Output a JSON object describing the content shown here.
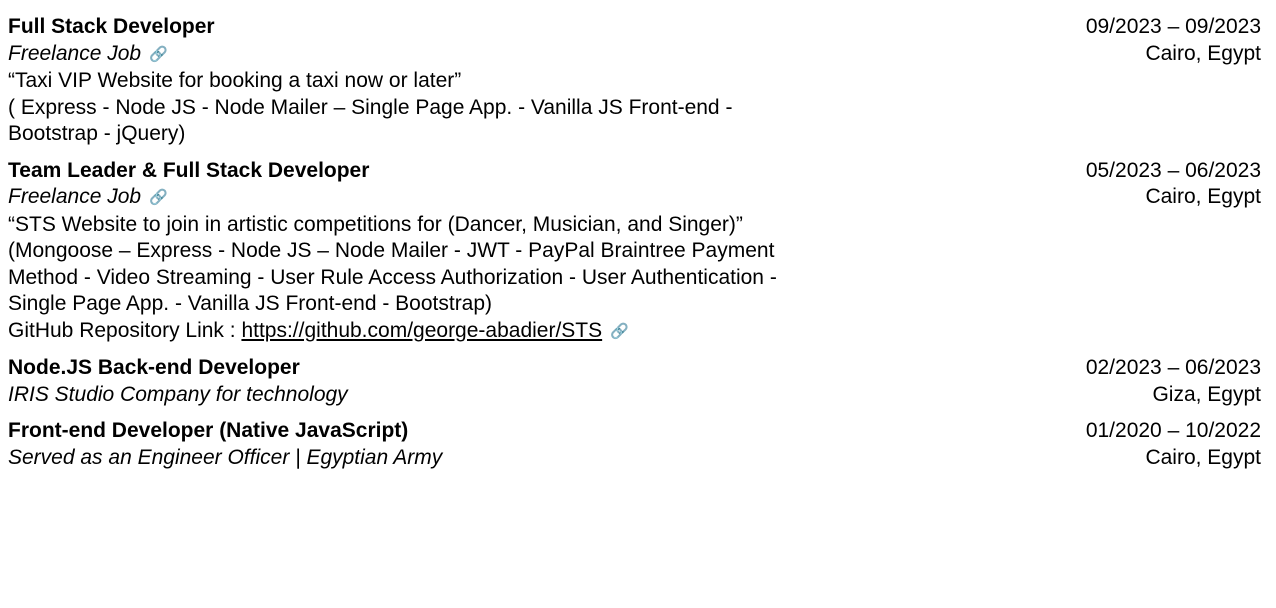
{
  "link_icon": "🔗",
  "entries": [
    {
      "title": "Full Stack Developer",
      "company": "Freelance Job",
      "has_link_icon": true,
      "lines": [
        "“Taxi VIP Website for booking a taxi now or later”",
        "( Express - Node JS - Node Mailer – Single Page App. - Vanilla JS Front-end - Bootstrap - jQuery)"
      ],
      "dates": "09/2023 – 09/2023",
      "location": "Cairo, Egypt"
    },
    {
      "title": "Team Leader & Full Stack Developer",
      "company": "Freelance Job",
      "has_link_icon": true,
      "lines": [
        "“STS Website to join in artistic competitions for (Dancer, Musician, and Singer)”",
        "(Mongoose – Express - Node JS – Node Mailer - JWT - PayPal Braintree Payment Method - Video Streaming - User Rule Access Authorization - User Authentication - Single Page App. - Vanilla JS Front-end - Bootstrap)"
      ],
      "repo_label": "GitHub Repository Link : ",
      "repo_url": "https://github.com/george-abadier/STS",
      "dates": "05/2023 – 06/2023",
      "location": "Cairo, Egypt"
    },
    {
      "title": "Node.JS Back-end Developer",
      "company": "IRIS Studio Company for technology",
      "dates": "02/2023 – 06/2023",
      "location": "Giza, Egypt"
    },
    {
      "title": "Front-end Developer (Native JavaScript)",
      "company": "Served as an Engineer Officer | Egyptian Army",
      "dates": "01/2020 – 10/2022",
      "location": "Cairo, Egypt"
    }
  ]
}
